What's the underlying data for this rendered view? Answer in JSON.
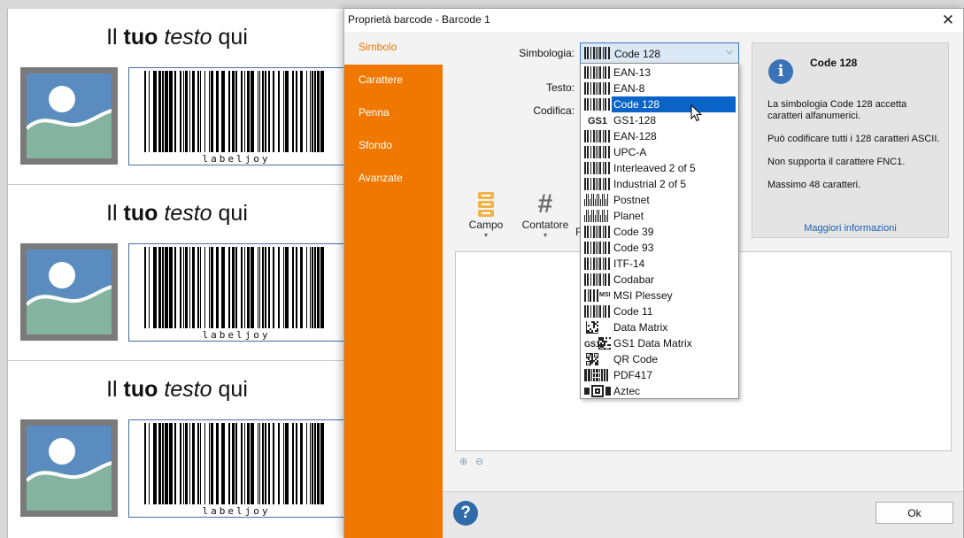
{
  "label_sheet": {
    "labels": [
      {
        "title_plain": "Il ",
        "title_bold": "tuo",
        "title_italic": "testo",
        "title_tail": " qui",
        "barcode_text": "labeljoy"
      },
      {
        "title_plain": "Il ",
        "title_bold": "tuo",
        "title_italic": "testo",
        "title_tail": " qui",
        "barcode_text": "labeljoy"
      },
      {
        "title_plain": "Il ",
        "title_bold": "tuo",
        "title_italic": "testo",
        "title_tail": " qui",
        "barcode_text": "labeljoy"
      }
    ]
  },
  "dialog": {
    "title": "Proprietà barcode - Barcode 1",
    "close_icon": "close-icon"
  },
  "sidebar": {
    "items": [
      {
        "label": "Simbolo",
        "active": true
      },
      {
        "label": "Carattere",
        "active": false
      },
      {
        "label": "Penna",
        "active": false
      },
      {
        "label": "Sfondo",
        "active": false
      },
      {
        "label": "Avanzate",
        "active": false
      }
    ],
    "accent_color": "#f07800"
  },
  "form": {
    "symbology_label": "Simbologia:",
    "symbology_value": "Code 128",
    "text_label": "Testo:",
    "encoding_label": "Codifica:"
  },
  "info": {
    "title": "Code 128",
    "line1": "La simbologia Code 128 accetta caratteri alfanumerici.",
    "line2": "Può codificare tutti i 128 caratteri ASCII.",
    "line3": "Non supporta il carattere FNC1.",
    "line4": "Massimo 48 caratteri.",
    "link": "Maggiori informazioni"
  },
  "tools": {
    "field_label": "Campo",
    "counter_label": "Contatore",
    "r_label": "R"
  },
  "symbology_options": [
    {
      "label": "EAN-13",
      "icon": "barcode-icon"
    },
    {
      "label": "EAN-8",
      "icon": "barcode-icon"
    },
    {
      "label": "Code 128",
      "icon": "barcode-icon",
      "selected": true
    },
    {
      "label": "GS1-128",
      "icon": "gs1-icon",
      "badge": "GS1"
    },
    {
      "label": "EAN-128",
      "icon": "barcode-icon"
    },
    {
      "label": "UPC-A",
      "icon": "barcode-icon"
    },
    {
      "label": "Interleaved 2 of 5",
      "icon": "barcode-icon"
    },
    {
      "label": "Industrial 2 of 5",
      "icon": "barcode-icon"
    },
    {
      "label": "Postnet",
      "icon": "postal-barcode-icon"
    },
    {
      "label": "Planet",
      "icon": "postal-barcode-icon"
    },
    {
      "label": "Code 39",
      "icon": "barcode-icon"
    },
    {
      "label": "Code 93",
      "icon": "barcode-icon"
    },
    {
      "label": "ITF-14",
      "icon": "barcode-icon"
    },
    {
      "label": "Codabar",
      "icon": "barcode-icon"
    },
    {
      "label": "MSI Plessey",
      "icon": "msi-icon",
      "badge": "MSI"
    },
    {
      "label": "Code 11",
      "icon": "barcode-icon"
    },
    {
      "label": "Data Matrix",
      "icon": "datamatrix-icon"
    },
    {
      "label": "GS1 Data Matrix",
      "icon": "gs1-datamatrix-icon",
      "badge": "GS1"
    },
    {
      "label": "QR Code",
      "icon": "qr-icon"
    },
    {
      "label": "PDF417",
      "icon": "pdf417-icon"
    },
    {
      "label": "Aztec",
      "icon": "aztec-icon"
    }
  ],
  "footer": {
    "ok_label": "Ok",
    "help_glyph": "?"
  },
  "info_glyph": "i",
  "counter_glyph": "#",
  "zoom_in_glyph": "⊕",
  "zoom_out_glyph": "⊖",
  "close_glyph": "✕",
  "chevron_glyph": "⌵"
}
